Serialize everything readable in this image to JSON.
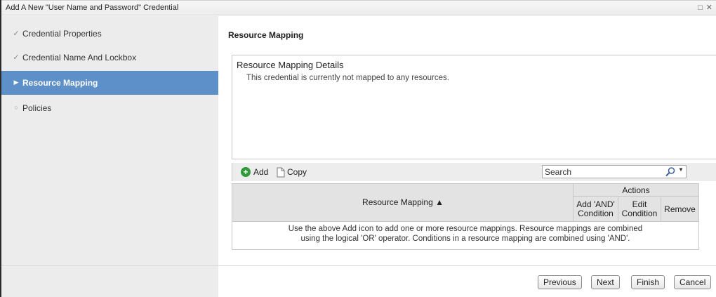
{
  "window": {
    "title": "Add A New \"User Name and Password\" Credential",
    "controls": [
      "□",
      "✕"
    ]
  },
  "sidebar": {
    "items": [
      {
        "label": "Credential Properties",
        "icon": "checkmark-icon",
        "glyph": "✓",
        "state": "done"
      },
      {
        "label": "Credential Name And Lockbox",
        "icon": "checkmark-icon",
        "glyph": "✓",
        "state": "done"
      },
      {
        "label": "Resource Mapping",
        "icon": "triangle-right-icon",
        "glyph": "▶",
        "state": "active"
      },
      {
        "label": "Policies",
        "icon": "circle-icon",
        "glyph": "○",
        "state": "pending"
      }
    ]
  },
  "main": {
    "section_title": "Resource Mapping",
    "details": {
      "title": "Resource Mapping Details",
      "message": "This credential is currently not mapped to any resources."
    },
    "toolbar": {
      "add_label": "Add",
      "copy_label": "Copy",
      "search_placeholder": "Search",
      "dropdown_glyph": "▼"
    },
    "table": {
      "column_main": "Resource Mapping ▲",
      "actions_header": "Actions",
      "action_add_and_line1": "Add 'AND'",
      "action_add_and_line2": "Condition",
      "action_edit_line1": "Edit",
      "action_edit_line2": "Condition",
      "action_remove": "Remove",
      "empty_line1": "Use the above Add icon to add one or more resource mappings. Resource mappings are combined",
      "empty_line2": "using the logical 'OR' operator. Conditions in a resource mapping are combined using 'AND'."
    }
  },
  "footer": {
    "previous_label": "Previous",
    "next_label": "Next",
    "finish_label": "Finish",
    "cancel_label": "Cancel"
  },
  "colors": {
    "active_nav": "#5d8fc8",
    "sidebar_bg": "#ececec",
    "add_icon": "#2f9a3a"
  }
}
